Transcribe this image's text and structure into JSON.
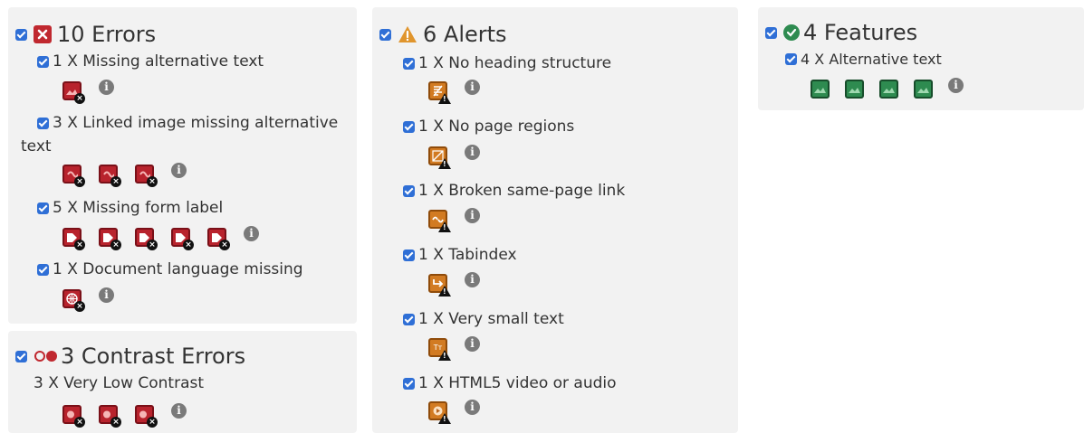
{
  "errors": {
    "title": "10 Errors",
    "items": [
      {
        "label": "1 X Missing alternative text"
      },
      {
        "label": "3 X Linked image missing alternative",
        "label_cont": "text"
      },
      {
        "label": "5 X Missing form label"
      },
      {
        "label": "1 X Document language missing"
      }
    ]
  },
  "contrast": {
    "title": "3 Contrast Errors",
    "items": [
      {
        "label": "3 X Very Low Contrast"
      }
    ]
  },
  "alerts": {
    "title": "6 Alerts",
    "items": [
      {
        "label": "1 X No heading structure"
      },
      {
        "label": "1 X No page regions"
      },
      {
        "label": "1 X Broken same-page link"
      },
      {
        "label": "1 X Tabindex"
      },
      {
        "label": "1 X Very small text"
      },
      {
        "label": "1 X HTML5 video or audio"
      }
    ]
  },
  "features": {
    "title": "4 Features",
    "items": [
      {
        "label": "4 X Alternative text"
      }
    ]
  },
  "colors": {
    "error": "#b8232d",
    "alert": "#d27b22",
    "feature": "#2e8b50",
    "checkbox": "#2f6fd6",
    "panel_bg": "#f2f2f2"
  },
  "icon_glyphs": {
    "error_badge": "×",
    "info": "i",
    "small_text": "Tт"
  }
}
